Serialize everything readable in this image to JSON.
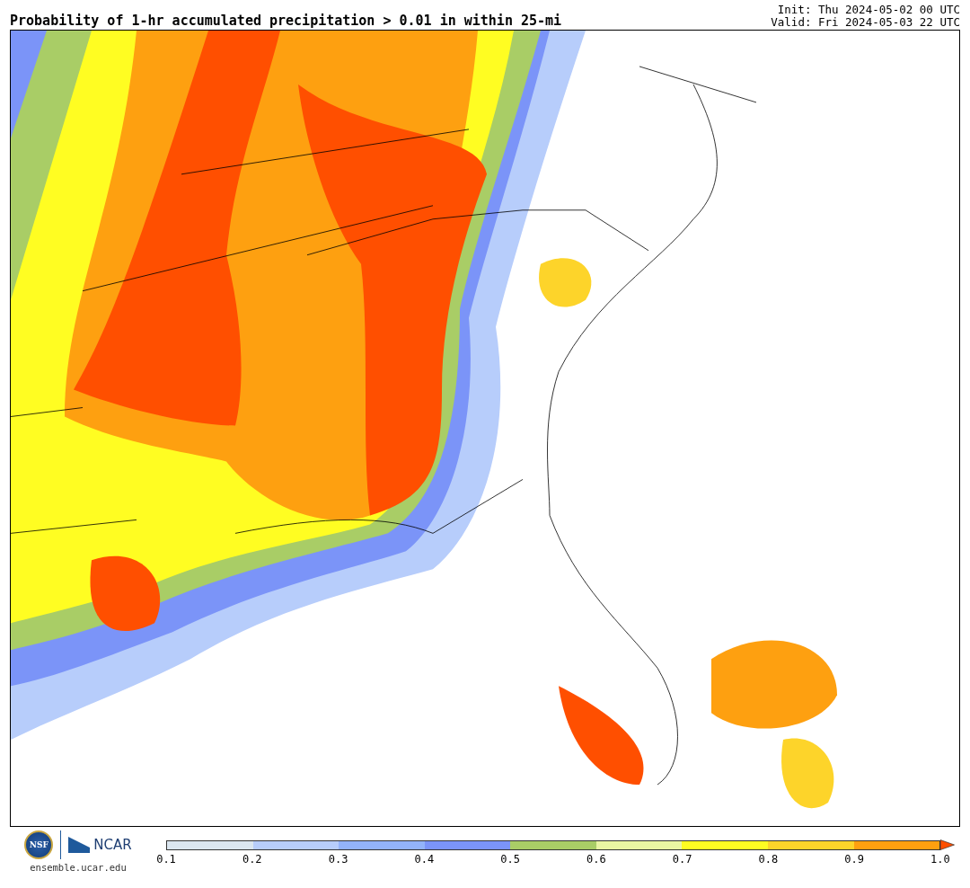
{
  "title": "Probability of 1-hr accumulated precipitation > 0.01 in within 25-mi",
  "init": "Init: Thu 2024-05-02 00 UTC",
  "valid": "Valid: Fri 2024-05-03 22 UTC",
  "logos": {
    "nsf": "NSF",
    "ncar": "NCAR",
    "site": "ensemble.ucar.edu"
  },
  "colorbar": {
    "segments": [
      {
        "kind": "box",
        "color": "#dbe6f0"
      },
      {
        "kind": "box",
        "color": "#b7cdfb"
      },
      {
        "kind": "box",
        "color": "#93b3fa"
      },
      {
        "kind": "box",
        "color": "#7b94f8"
      },
      {
        "kind": "box",
        "color": "#a9cd66"
      },
      {
        "kind": "box",
        "color": "#eaf5a3"
      },
      {
        "kind": "box",
        "color": "#fffd22"
      },
      {
        "kind": "box",
        "color": "#fdd42a"
      },
      {
        "kind": "box",
        "color": "#fea010"
      },
      {
        "kind": "arrow",
        "color": "#ff4f00"
      }
    ],
    "ticks": [
      "0.1",
      "0.2",
      "0.3",
      "0.4",
      "0.5",
      "0.6",
      "0.7",
      "0.8",
      "0.9",
      "1.0"
    ]
  }
}
